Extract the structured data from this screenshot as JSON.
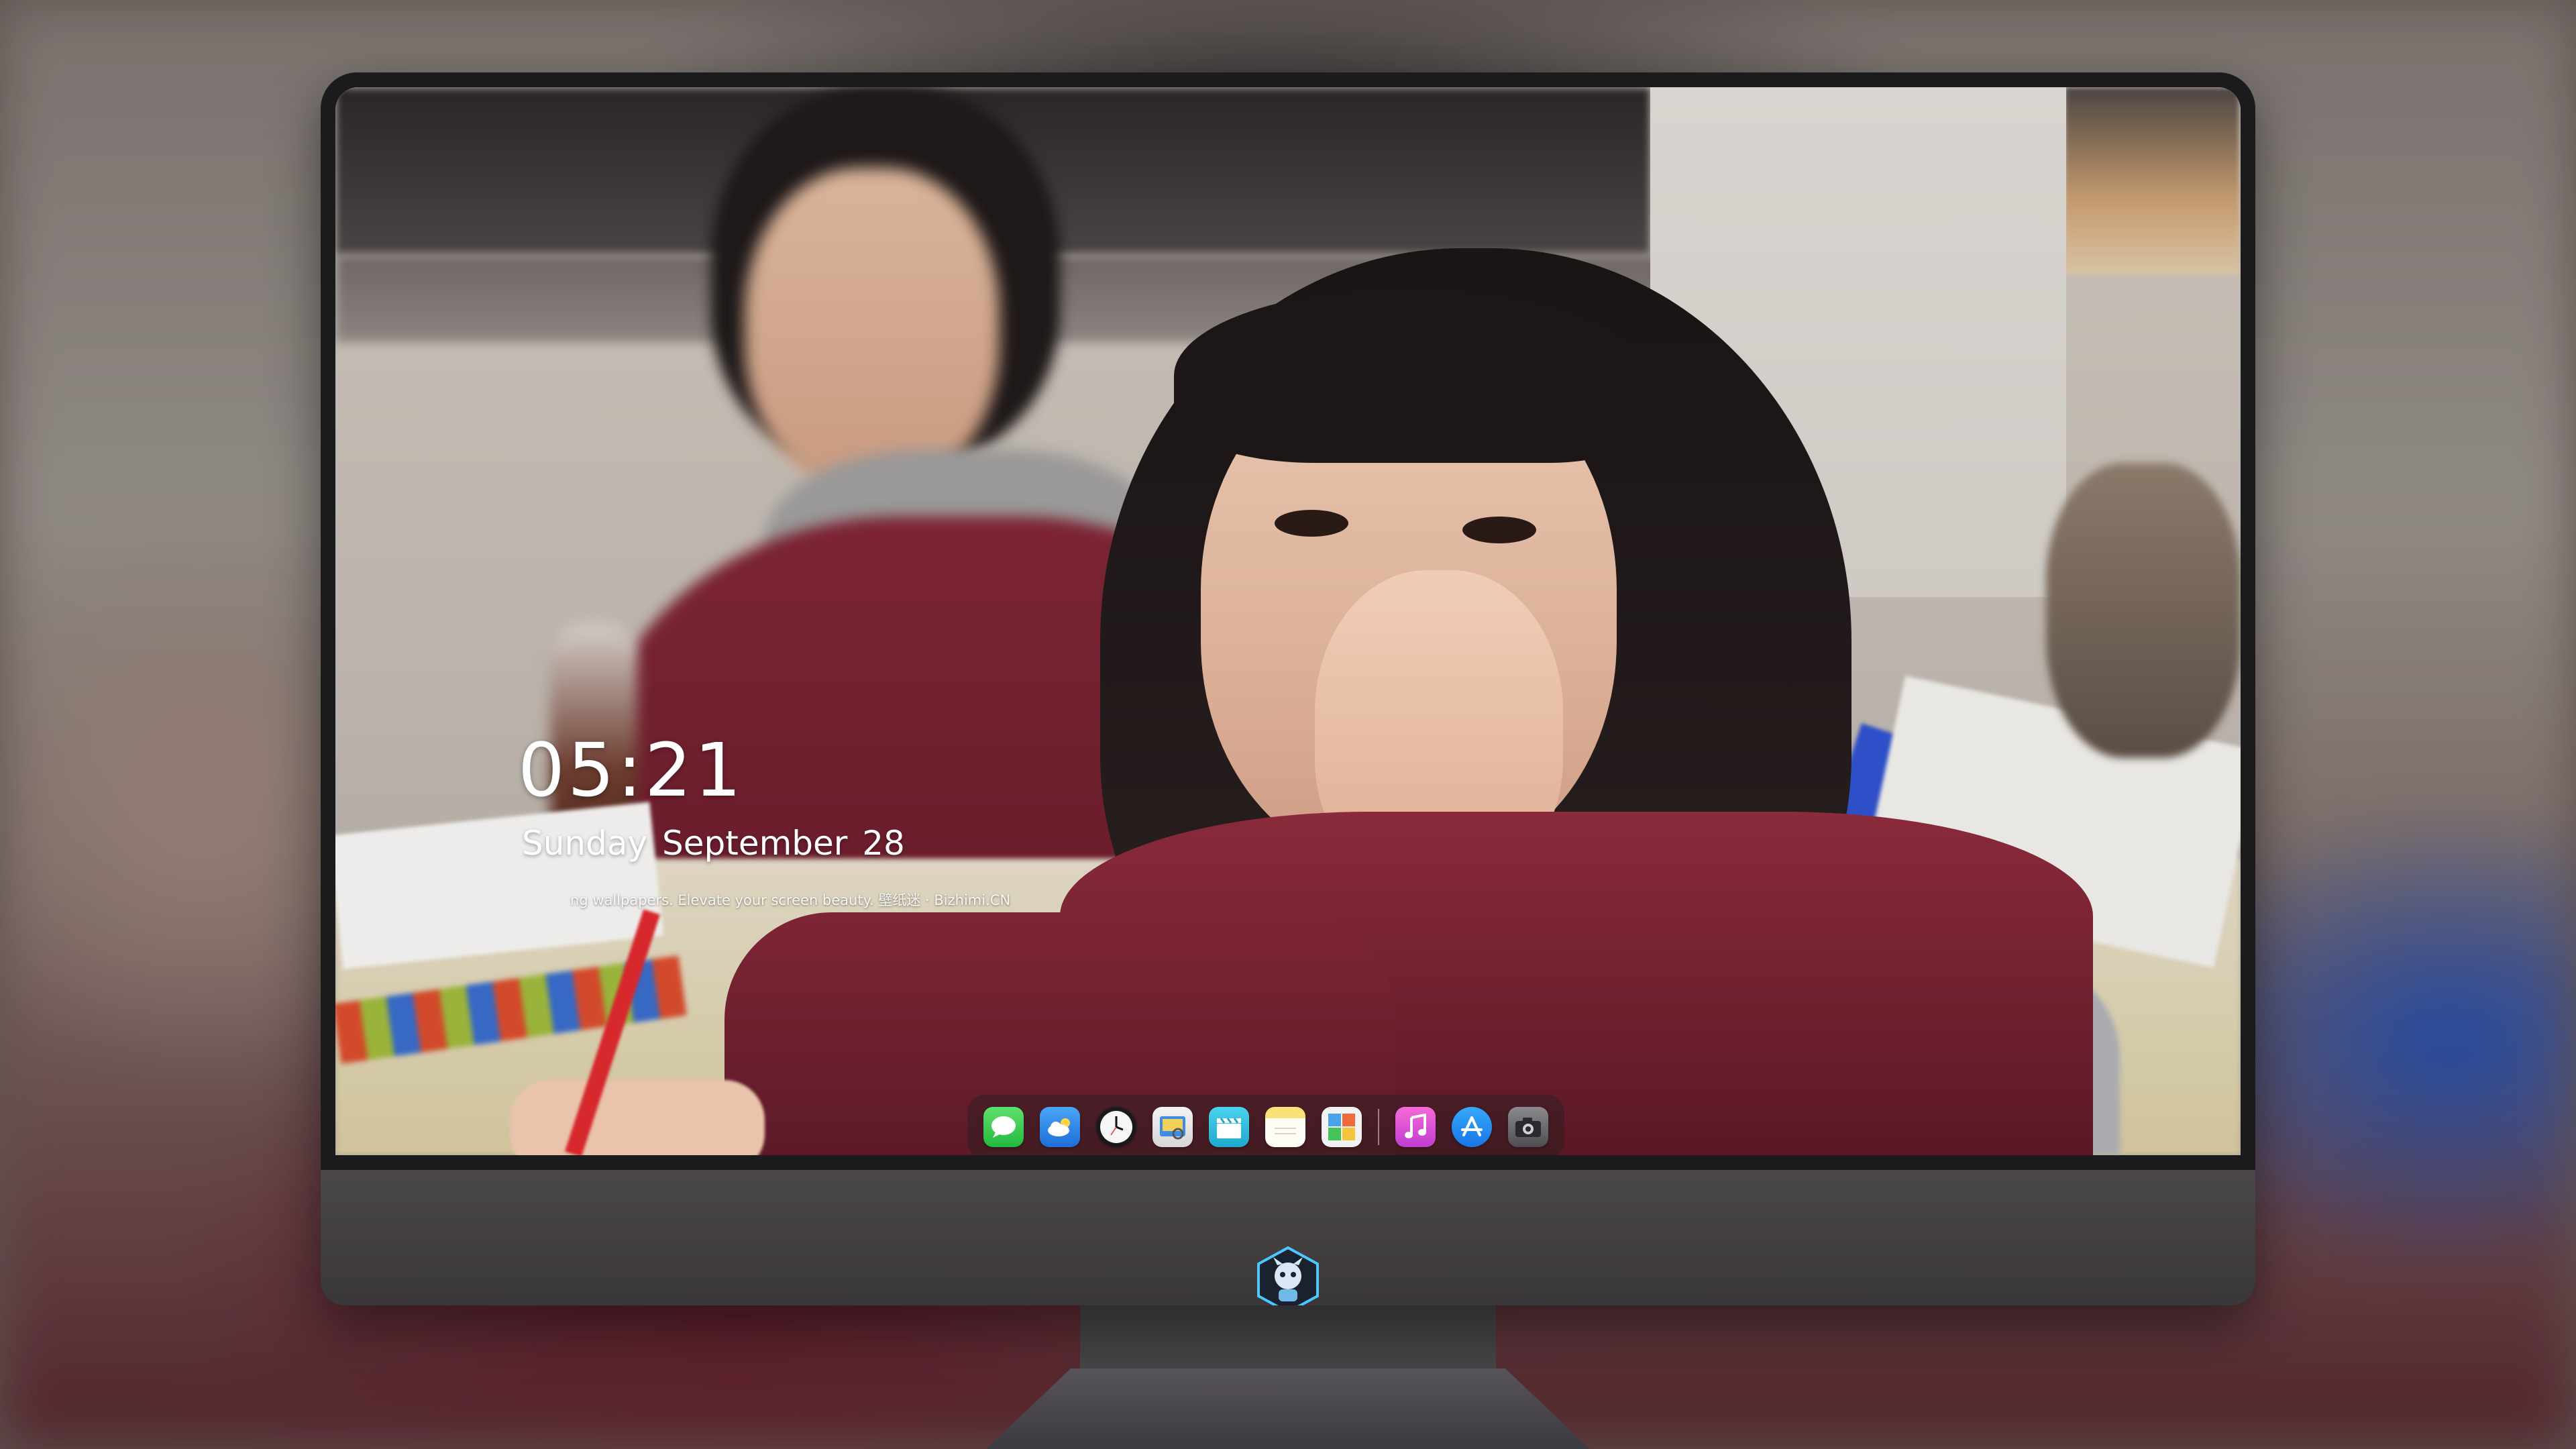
{
  "lockscreen": {
    "time": "05:21",
    "date": "Sunday September  28",
    "tagline": "ng wallpapers. Elevate your screen beauty. 壁纸迷 · Bizhimi.CN"
  },
  "dock": {
    "apps": [
      {
        "name": "messages",
        "icon": "message-bubble-icon",
        "color": "#31c94a"
      },
      {
        "name": "weather",
        "icon": "cloud-icon",
        "color": "#2f8ef0"
      },
      {
        "name": "clock",
        "icon": "clock-icon",
        "color": "#f4f4f4"
      },
      {
        "name": "preview",
        "icon": "photo-viewer-icon",
        "color": "#3a8de0"
      },
      {
        "name": "clips",
        "icon": "clapperboard-icon",
        "color": "#36c7e6"
      },
      {
        "name": "notes",
        "icon": "notes-icon",
        "color": "#f8d33e"
      },
      {
        "name": "photo-booth",
        "icon": "photo-grid-icon",
        "color": "#4aa3e8"
      },
      {
        "name": "music",
        "icon": "music-note-icon",
        "color": "#e14dc3"
      },
      {
        "name": "app-store",
        "icon": "app-store-icon",
        "color": "#1f8cf5"
      },
      {
        "name": "camera",
        "icon": "camera-icon",
        "color": "#6f6f73"
      }
    ]
  },
  "colors": {
    "jacket": "#7a2232",
    "bezel": "#1b1b1d",
    "chin": "#433f42"
  }
}
